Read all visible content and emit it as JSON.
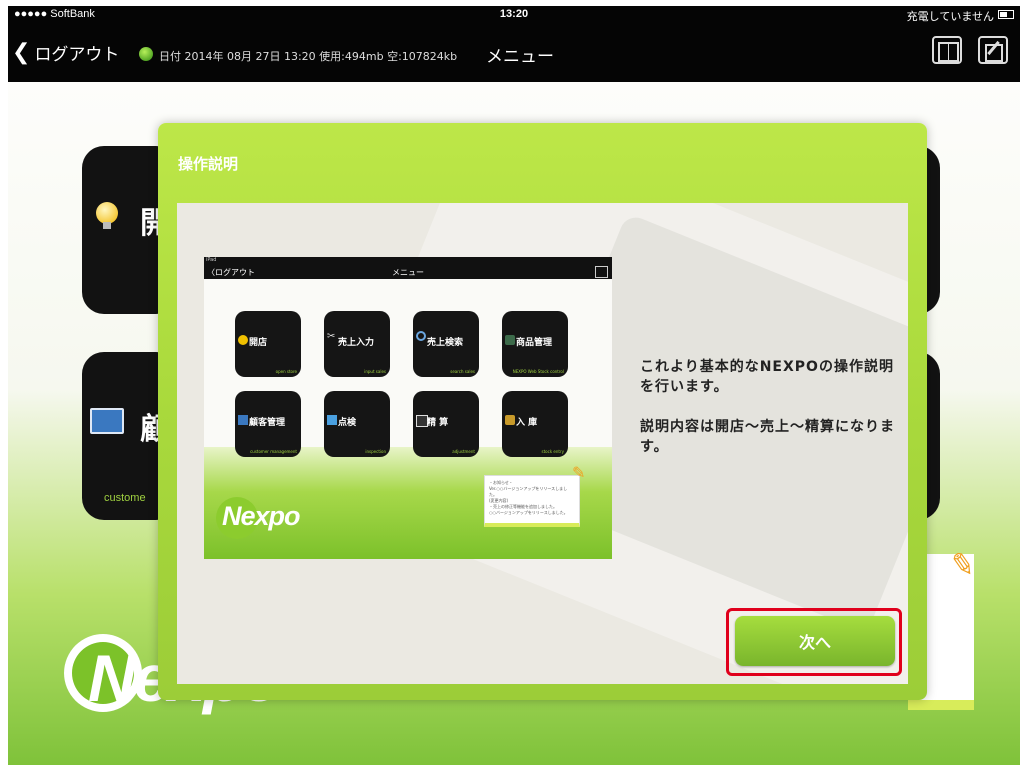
{
  "status_bar": {
    "carrier": "●●●●● SoftBank",
    "time": "13:20",
    "charge": "充電していません"
  },
  "nav": {
    "back_label": "ログアウト",
    "info": "日付 2014年 08月 27日 13:20 使用:494mb 空:107824kb",
    "title": "メニュー"
  },
  "background": {
    "char_1": "開",
    "char_2": "顧",
    "sub_2": "custome",
    "logo_text": "Nexpo"
  },
  "modal": {
    "title": "操作説明",
    "message_1": "これより基本的なNEXPOの操作説明を行います。",
    "message_2": "説明内容は開店～売上～精算になります。",
    "next_label": "次へ"
  },
  "mini": {
    "status": "iPad",
    "back_label": "〈ログアウト",
    "title": "メニュー",
    "tiles": [
      {
        "label": "開店",
        "sub": "open store",
        "icon": "bulb-icon"
      },
      {
        "label": "売上入力",
        "sub": "input sales",
        "icon": "scissors-icon"
      },
      {
        "label": "売上検索",
        "sub": "search sales",
        "icon": "magnifier-icon"
      },
      {
        "label": "商品管理",
        "sub": "NEXPO Web Stock control",
        "icon": "box-icon"
      },
      {
        "label": "顧客管理",
        "sub": "customer management",
        "icon": "card-icon"
      },
      {
        "label": "点検",
        "sub": "inspection",
        "icon": "check-icon"
      },
      {
        "label": "精 算",
        "sub": "adjustment",
        "icon": "calculator-icon"
      },
      {
        "label": "入 庫",
        "sub": "stock entry",
        "icon": "box-icon"
      }
    ],
    "logo_text": "Nexpo",
    "note_1": "・お知らせ・",
    "note_2": "Ver.○○バージョンアップをリリースしました。",
    "note_3": "(変更内容)",
    "note_4": "・売上の修正等機能を追加しました。",
    "note_5": "○○バージョンアップをリリースしました。"
  },
  "colors": {
    "accent": "#a9d93c",
    "highlight": "#e0001c",
    "button": "#8cc636"
  }
}
